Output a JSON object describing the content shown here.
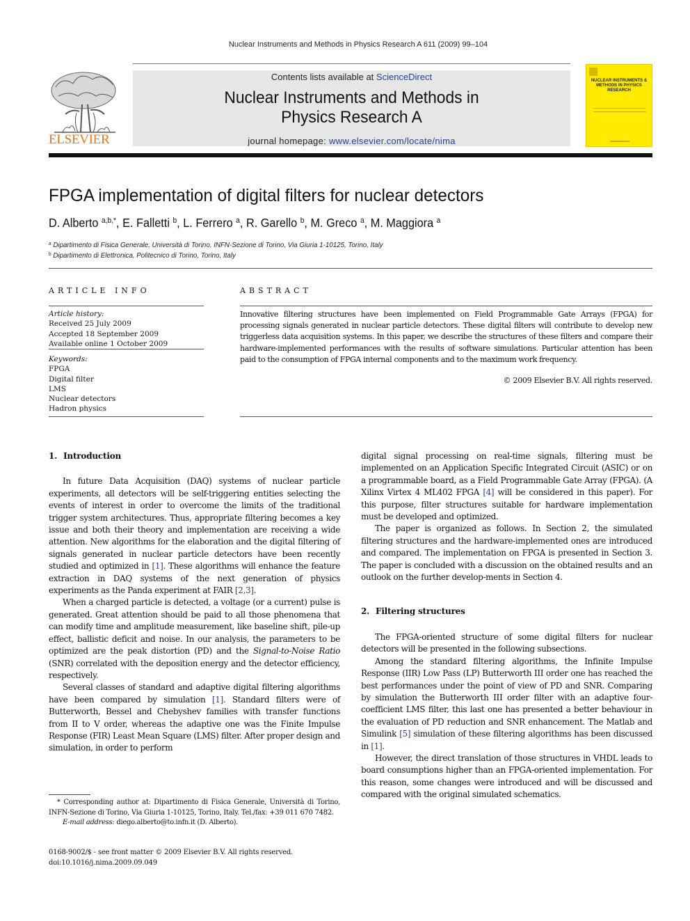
{
  "running_head": "Nuclear Instruments and Methods in Physics Research A 611 (2009) 99–104",
  "masthead": {
    "publisher": "ELSEVIER",
    "contents_prefix": "Contents lists available at ",
    "contents_link": "ScienceDirect",
    "journal_title_line1": "Nuclear Instruments and Methods in",
    "journal_title_line2": "Physics Research A",
    "homepage_prefix": "journal homepage: ",
    "homepage_link": "www.elsevier.com/locate/nima",
    "cover_title": "NUCLEAR INSTRUMENTS & METHODS IN PHYSICS RESEARCH",
    "colors": {
      "cover": "#ffeb00",
      "publisher": "#e8771c",
      "link": "#2a3f8f",
      "masthead_bg": "#e6e6e6"
    }
  },
  "article": {
    "title": "FPGA implementation of digital filters for nuclear detectors",
    "authors": [
      {
        "name": "D. Alberto",
        "sup": "a,b,*",
        "sep": ", "
      },
      {
        "name": "E. Falletti",
        "sup": "b",
        "sep": ", "
      },
      {
        "name": "L. Ferrero",
        "sup": "a",
        "sep": ", "
      },
      {
        "name": "R. Garello",
        "sup": "b",
        "sep": ", "
      },
      {
        "name": "M. Greco",
        "sup": "a",
        "sep": ", "
      },
      {
        "name": "M. Maggiora",
        "sup": "a",
        "sep": ""
      }
    ],
    "affiliations": [
      {
        "sup": "a",
        "text": "Dipartimento di Fisica Generale, Università di Torino, INFN-Sezione di Torino, Via Giuria 1-10125, Torino, Italy"
      },
      {
        "sup": "b",
        "text": "Dipartimento di Elettronica, Politecnico di Torino, Torino, Italy"
      }
    ]
  },
  "article_info": {
    "heading": "ARTICLE INFO",
    "history_label": "Article history:",
    "history": [
      "Received 25 July 2009",
      "Accepted 18 September 2009",
      "Available online 1 October 2009"
    ],
    "keywords_label": "Keywords:",
    "keywords": [
      "FPGA",
      "Digital filter",
      "LMS",
      "Nuclear detectors",
      "Hadron physics"
    ]
  },
  "abstract": {
    "heading": "ABSTRACT",
    "text": "Innovative filtering structures have been implemented on Field Programmable Gate Arrays (FPGA) for processing signals generated in nuclear particle detectors. These digital filters will contribute to develop new triggerless data acquisition systems. In this paper, we describe the structures of these filters and compare their hardware-implemented performances with the results of software simulations. Particular attention has been paid to the consumption of FPGA internal components and to the maximum work frequency.",
    "copyright": "© 2009 Elsevier B.V. All rights reserved."
  },
  "body": {
    "section1": {
      "number": "1.",
      "title": "Introduction",
      "p1": [
        {
          "t": "In future Data Acquisition (DAQ) systems of nuclear particle experiments, all detectors will be self-triggering entities selecting the events of interest in order to overcome the limits of the traditional trigger system architectures. Thus, appropriate filtering becomes a key issue and both their theory and implementation are receiving a wide attention. New algorithms for the elaboration and the digital filtering of signals generated in nuclear particle detectors have been recently studied and optimized in "
        },
        {
          "ref": "[1]"
        },
        {
          "t": ". These algorithms will enhance the feature extraction in DAQ systems of the next generation of physics experiments as the Panda experiment at FAIR "
        },
        {
          "ref": "[2,3]"
        },
        {
          "t": "."
        }
      ],
      "p2": [
        {
          "t": "When a charged particle is detected, a voltage (or a current) pulse is generated. Great attention should be paid to all those phenomena that can modify time and amplitude measurement, like baseline shift, pile-up effect, ballistic deficit and noise. In our analysis, the parameters to be optimized are the peak distortion (PD) and the "
        },
        {
          "it": "Signal-to-Noise Ratio"
        },
        {
          "t": " (SNR) correlated with the deposition energy and the detector efficiency, respectively."
        }
      ],
      "p3": [
        {
          "t": "Several classes of standard and adaptive digital filtering algorithms have been compared by simulation "
        },
        {
          "ref": "[1]"
        },
        {
          "t": ". Standard filters were of Butterworth, Bessel and Chebyshev families with transfer functions from II to V order, whereas the adaptive one was the Finite Impulse Response (FIR) Least Mean Square (LMS) filter. After proper design and simulation, in order to perform"
        }
      ],
      "p4": [
        {
          "t": "digital signal processing on real-time signals, filtering must be implemented on an Application Specific Integrated Circuit (ASIC) or on a programmable board, as a Field Programmable Gate Array (FPGA). (A Xilinx Virtex 4 ML402 FPGA "
        },
        {
          "ref": "[4]"
        },
        {
          "t": " will be considered in this paper). For this purpose, filter structures suitable for hardware implementation must be developed and optimized."
        }
      ],
      "p5": [
        {
          "t": "The paper is organized as follows. In Section 2, the simulated filtering structures and the hardware-implemented ones are introduced and compared. The implementation on FPGA is presented in Section 3. The paper is concluded with a discussion on the obtained results and an outlook on the further develop-ments in Section 4."
        }
      ]
    },
    "section2": {
      "number": "2.",
      "title": "Filtering structures",
      "p1": [
        {
          "t": "The FPGA-oriented structure of some digital filters for nuclear detectors will be presented in the following subsections."
        }
      ],
      "p2": [
        {
          "t": "Among the standard filtering algorithms, the Infinite Impulse Response (IIR) Low Pass (LP) Butterworth III order one has reached the best performances under the point of view of PD and SNR. Comparing by simulation the Butterworth III order filter with an adaptive four-coefficient LMS filter, this last one has presented a better behaviour in the evaluation of PD reduction and SNR enhancement. The Matlab and Simulink "
        },
        {
          "ref": "[5]"
        },
        {
          "t": " simulation of these filtering algorithms has been discussed in "
        },
        {
          "ref": "[1]"
        },
        {
          "t": "."
        }
      ],
      "p3": [
        {
          "t": "However, the direct translation of those structures in VHDL leads to board consumptions higher than an FPGA-oriented implementation. For this reason, some changes were introduced and will be discussed and compared with the original simulated schematics."
        }
      ]
    }
  },
  "footnote": {
    "corresponding": "* Corresponding author at: Dipartimento di Fisica Generale, Università di Torino, INFN-Sezione di Torino, Via Giuria 1-10125, Torino, Italy. Tel./fax: +39 011 670 7482.",
    "email_label": "E-mail address:",
    "email": " diego.alberto@to.infn.it (D. Alberto)."
  },
  "front_matter": {
    "issn_line": "0168-9002/$ - see front matter © 2009 Elsevier B.V. All rights reserved.",
    "doi": "doi:10.1016/j.nima.2009.09.049"
  }
}
